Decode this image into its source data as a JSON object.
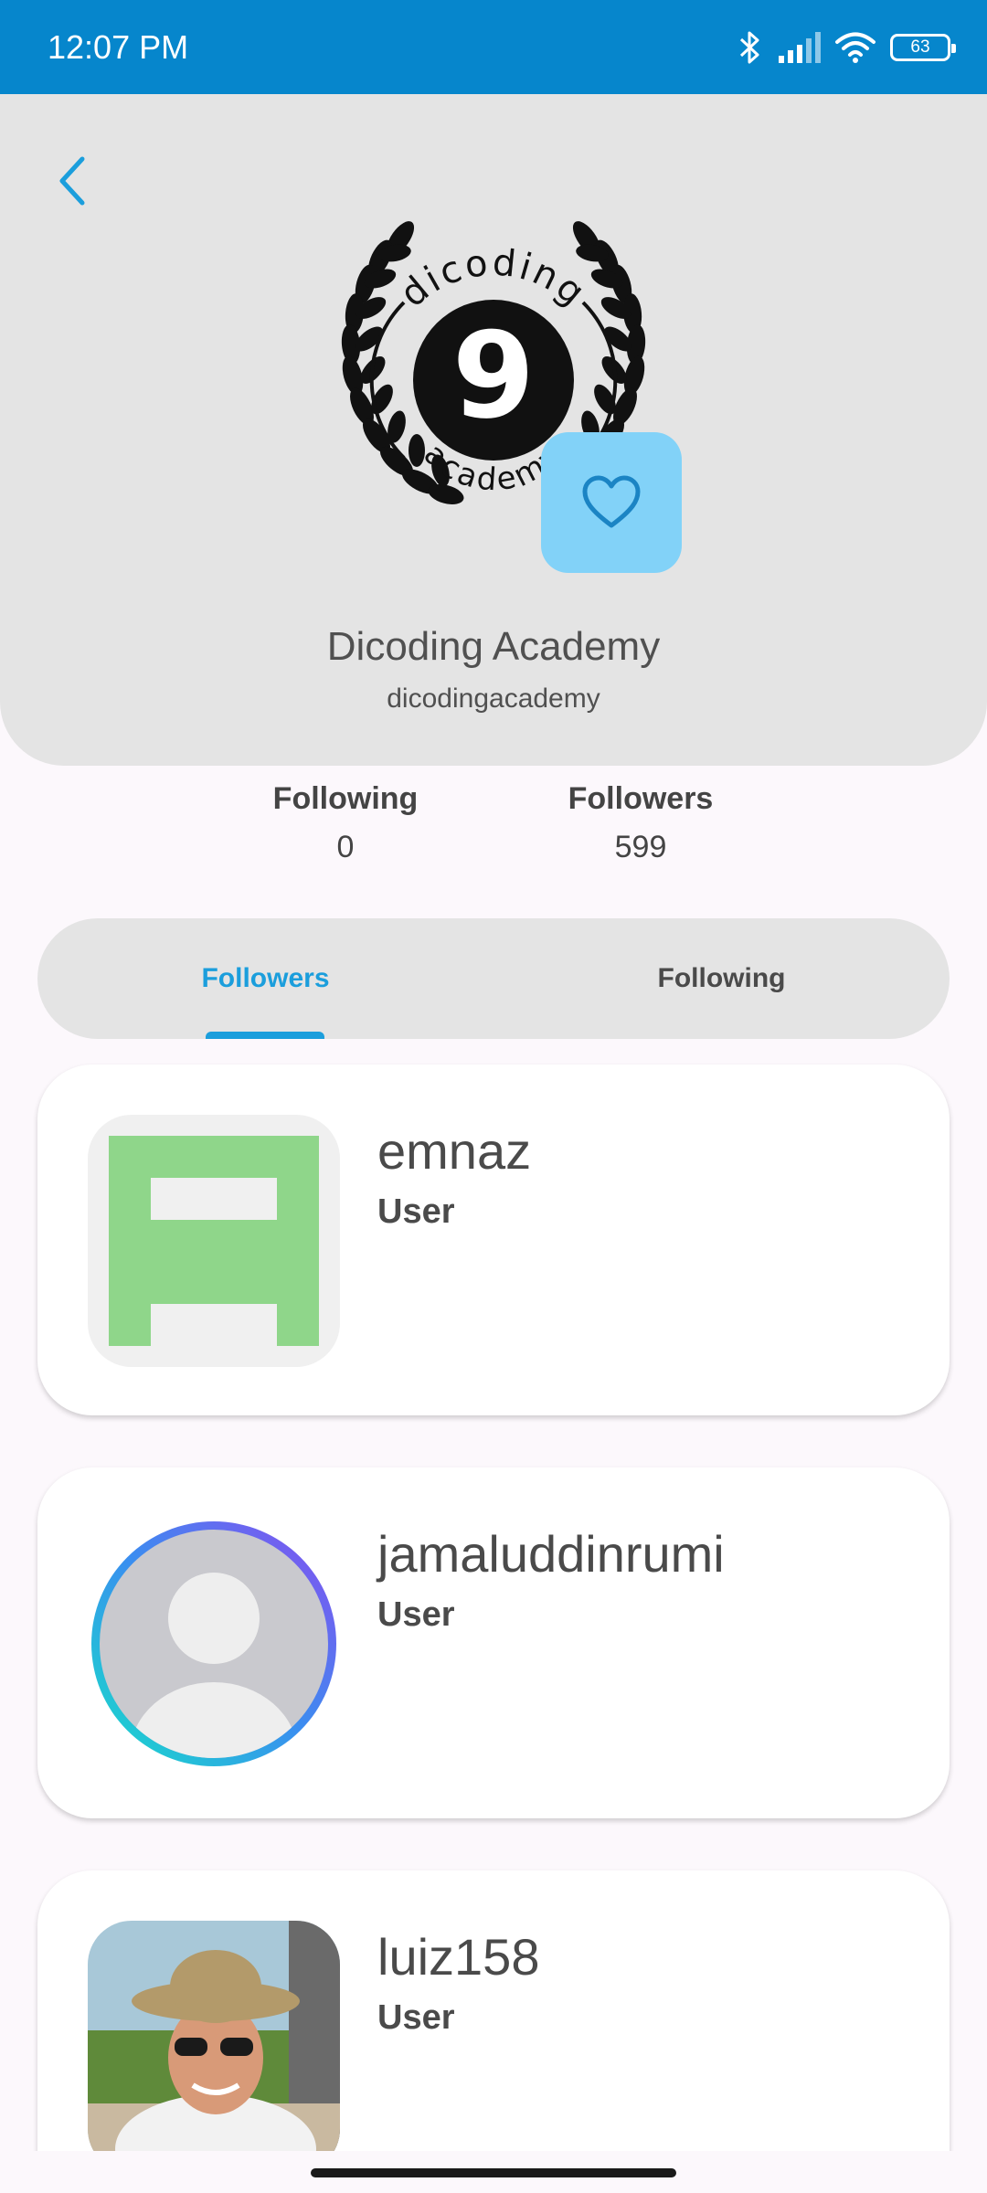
{
  "status_bar": {
    "time": "12:07 PM",
    "battery": "63",
    "icons": [
      "bluetooth-icon",
      "signal-icon",
      "wifi-icon",
      "battery-icon"
    ]
  },
  "header": {
    "back_icon": "chevron-left-icon",
    "logo": {
      "top_text": "dicoding",
      "bottom_text": "academy",
      "center_glyph": "9"
    },
    "favorite_icon": "heart-outline-icon",
    "name": "Dicoding Academy",
    "username": "dicodingacademy"
  },
  "stats": {
    "following_label": "Following",
    "following_value": "0",
    "followers_label": "Followers",
    "followers_value": "599"
  },
  "tabs": [
    {
      "label": "Followers",
      "active": true
    },
    {
      "label": "Following",
      "active": false
    }
  ],
  "users": [
    {
      "username": "emnaz",
      "type": "User",
      "avatar": "identicon"
    },
    {
      "username": "jamaluddinrumi",
      "type": "User",
      "avatar": "default-person"
    },
    {
      "username": "luiz158",
      "type": "User",
      "avatar": "photo"
    }
  ],
  "colors": {
    "status_bar": "#0686cc",
    "accent": "#1b9edc",
    "header_bg": "#e4e4e4",
    "favorite_bg": "#82d2f8",
    "identicon": "#8fd68a"
  }
}
